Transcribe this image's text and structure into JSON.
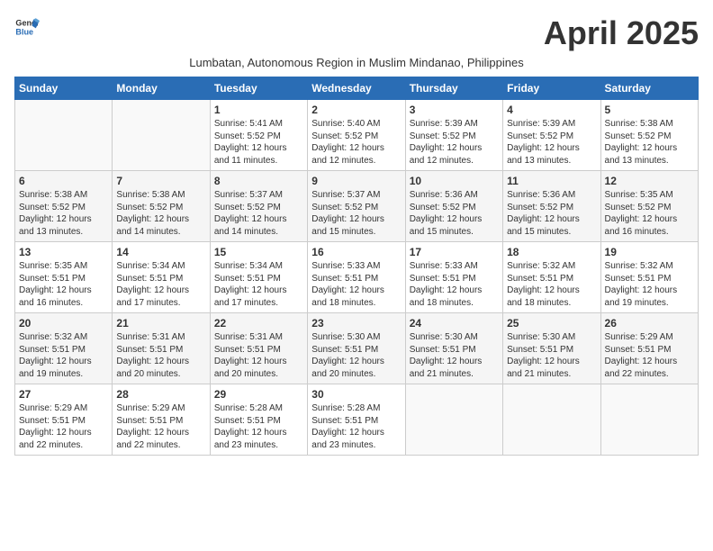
{
  "logo": {
    "line1": "General",
    "line2": "Blue"
  },
  "title": "April 2025",
  "subtitle": "Lumbatan, Autonomous Region in Muslim Mindanao, Philippines",
  "weekdays": [
    "Sunday",
    "Monday",
    "Tuesday",
    "Wednesday",
    "Thursday",
    "Friday",
    "Saturday"
  ],
  "weeks": [
    [
      {
        "day": "",
        "info": ""
      },
      {
        "day": "",
        "info": ""
      },
      {
        "day": "1",
        "info": "Sunrise: 5:41 AM\nSunset: 5:52 PM\nDaylight: 12 hours and 11 minutes."
      },
      {
        "day": "2",
        "info": "Sunrise: 5:40 AM\nSunset: 5:52 PM\nDaylight: 12 hours and 12 minutes."
      },
      {
        "day": "3",
        "info": "Sunrise: 5:39 AM\nSunset: 5:52 PM\nDaylight: 12 hours and 12 minutes."
      },
      {
        "day": "4",
        "info": "Sunrise: 5:39 AM\nSunset: 5:52 PM\nDaylight: 12 hours and 13 minutes."
      },
      {
        "day": "5",
        "info": "Sunrise: 5:38 AM\nSunset: 5:52 PM\nDaylight: 12 hours and 13 minutes."
      }
    ],
    [
      {
        "day": "6",
        "info": "Sunrise: 5:38 AM\nSunset: 5:52 PM\nDaylight: 12 hours and 13 minutes."
      },
      {
        "day": "7",
        "info": "Sunrise: 5:38 AM\nSunset: 5:52 PM\nDaylight: 12 hours and 14 minutes."
      },
      {
        "day": "8",
        "info": "Sunrise: 5:37 AM\nSunset: 5:52 PM\nDaylight: 12 hours and 14 minutes."
      },
      {
        "day": "9",
        "info": "Sunrise: 5:37 AM\nSunset: 5:52 PM\nDaylight: 12 hours and 15 minutes."
      },
      {
        "day": "10",
        "info": "Sunrise: 5:36 AM\nSunset: 5:52 PM\nDaylight: 12 hours and 15 minutes."
      },
      {
        "day": "11",
        "info": "Sunrise: 5:36 AM\nSunset: 5:52 PM\nDaylight: 12 hours and 15 minutes."
      },
      {
        "day": "12",
        "info": "Sunrise: 5:35 AM\nSunset: 5:52 PM\nDaylight: 12 hours and 16 minutes."
      }
    ],
    [
      {
        "day": "13",
        "info": "Sunrise: 5:35 AM\nSunset: 5:51 PM\nDaylight: 12 hours and 16 minutes."
      },
      {
        "day": "14",
        "info": "Sunrise: 5:34 AM\nSunset: 5:51 PM\nDaylight: 12 hours and 17 minutes."
      },
      {
        "day": "15",
        "info": "Sunrise: 5:34 AM\nSunset: 5:51 PM\nDaylight: 12 hours and 17 minutes."
      },
      {
        "day": "16",
        "info": "Sunrise: 5:33 AM\nSunset: 5:51 PM\nDaylight: 12 hours and 18 minutes."
      },
      {
        "day": "17",
        "info": "Sunrise: 5:33 AM\nSunset: 5:51 PM\nDaylight: 12 hours and 18 minutes."
      },
      {
        "day": "18",
        "info": "Sunrise: 5:32 AM\nSunset: 5:51 PM\nDaylight: 12 hours and 18 minutes."
      },
      {
        "day": "19",
        "info": "Sunrise: 5:32 AM\nSunset: 5:51 PM\nDaylight: 12 hours and 19 minutes."
      }
    ],
    [
      {
        "day": "20",
        "info": "Sunrise: 5:32 AM\nSunset: 5:51 PM\nDaylight: 12 hours and 19 minutes."
      },
      {
        "day": "21",
        "info": "Sunrise: 5:31 AM\nSunset: 5:51 PM\nDaylight: 12 hours and 20 minutes."
      },
      {
        "day": "22",
        "info": "Sunrise: 5:31 AM\nSunset: 5:51 PM\nDaylight: 12 hours and 20 minutes."
      },
      {
        "day": "23",
        "info": "Sunrise: 5:30 AM\nSunset: 5:51 PM\nDaylight: 12 hours and 20 minutes."
      },
      {
        "day": "24",
        "info": "Sunrise: 5:30 AM\nSunset: 5:51 PM\nDaylight: 12 hours and 21 minutes."
      },
      {
        "day": "25",
        "info": "Sunrise: 5:30 AM\nSunset: 5:51 PM\nDaylight: 12 hours and 21 minutes."
      },
      {
        "day": "26",
        "info": "Sunrise: 5:29 AM\nSunset: 5:51 PM\nDaylight: 12 hours and 22 minutes."
      }
    ],
    [
      {
        "day": "27",
        "info": "Sunrise: 5:29 AM\nSunset: 5:51 PM\nDaylight: 12 hours and 22 minutes."
      },
      {
        "day": "28",
        "info": "Sunrise: 5:29 AM\nSunset: 5:51 PM\nDaylight: 12 hours and 22 minutes."
      },
      {
        "day": "29",
        "info": "Sunrise: 5:28 AM\nSunset: 5:51 PM\nDaylight: 12 hours and 23 minutes."
      },
      {
        "day": "30",
        "info": "Sunrise: 5:28 AM\nSunset: 5:51 PM\nDaylight: 12 hours and 23 minutes."
      },
      {
        "day": "",
        "info": ""
      },
      {
        "day": "",
        "info": ""
      },
      {
        "day": "",
        "info": ""
      }
    ]
  ]
}
